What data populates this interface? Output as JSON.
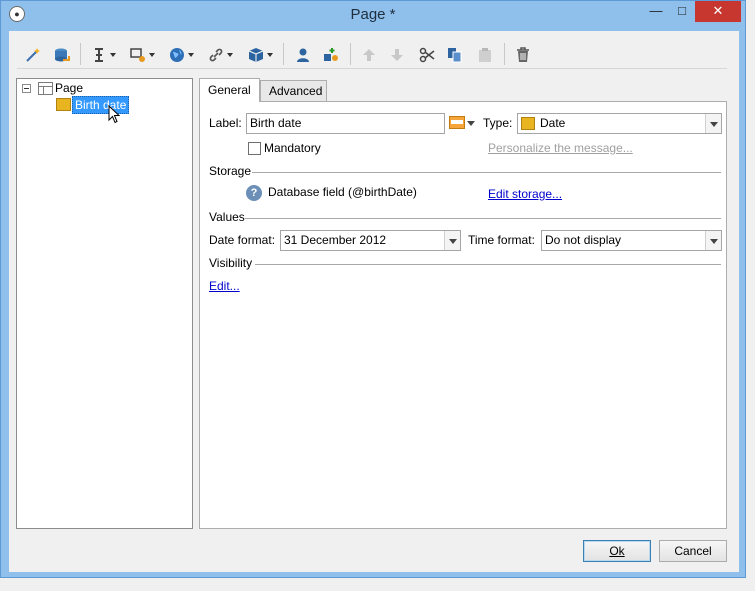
{
  "window": {
    "title": "Page  *",
    "minimize_glyph": "—",
    "maximize_glyph": "□",
    "close_glyph": "✕"
  },
  "toolbar": {
    "items": [
      {
        "icon": "wizard-icon"
      },
      {
        "icon": "database-link-icon"
      },
      {
        "icon": "text-cursor-icon",
        "has_dropdown": true
      },
      {
        "icon": "field-settings-icon",
        "has_dropdown": true
      },
      {
        "icon": "globe-icon",
        "has_dropdown": true
      },
      {
        "icon": "link-icon",
        "has_dropdown": true
      },
      {
        "icon": "box-icon",
        "has_dropdown": true
      },
      {
        "icon": "user-icon"
      },
      {
        "icon": "add-shapes-icon"
      },
      {
        "icon": "move-up-icon",
        "disabled": true
      },
      {
        "icon": "move-down-icon",
        "disabled": true
      },
      {
        "icon": "cut-icon"
      },
      {
        "icon": "copy-icon"
      },
      {
        "icon": "paste-icon",
        "disabled": true
      },
      {
        "icon": "delete-icon"
      }
    ]
  },
  "tree": {
    "root_label": "Page",
    "child_label": "Birth date"
  },
  "tabs": {
    "general": "General",
    "advanced": "Advanced"
  },
  "general": {
    "label_caption": "Label:",
    "label_value": "Birth date",
    "type_caption": "Type:",
    "type_value": "Date",
    "mandatory_label": "Mandatory",
    "mandatory_checked": false,
    "personalize_link": "Personalize the message...",
    "storage_title": "Storage",
    "storage_field": "Database field (@birthDate)",
    "edit_storage_link": "Edit storage...",
    "values_title": "Values",
    "date_format_caption": "Date format:",
    "date_format_value": "31 December 2012",
    "time_format_caption": "Time format:",
    "time_format_value": "Do not display",
    "visibility_title": "Visibility",
    "edit_link": "Edit..."
  },
  "buttons": {
    "ok": "Ok",
    "cancel": "Cancel"
  },
  "colors": {
    "titlebar": "#8fc0ec",
    "close_button": "#c7372f",
    "selection": "#3399ff",
    "link": "#0000cc",
    "field_icon": "#e8b420"
  }
}
